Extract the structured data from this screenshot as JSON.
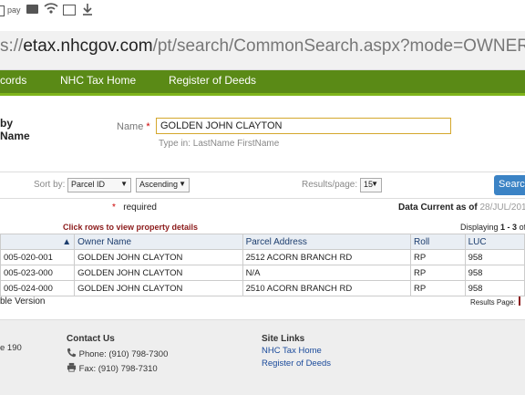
{
  "statusbar": {
    "pay_label": "pay"
  },
  "browser": {
    "url_prefix": "s://",
    "url_host": "etax.nhcgov.com",
    "url_path": "/pt/search/CommonSearch.aspx?mode=OWNER"
  },
  "nav": {
    "items": [
      "cords",
      "NHC Tax Home",
      "Register of Deeds"
    ]
  },
  "search": {
    "side_label_1": "by",
    "side_label_2": "Name",
    "name_label": "Name",
    "required_star": "*",
    "name_value": "GOLDEN JOHN CLAYTON",
    "name_hint": "Type in: LastName FirstName",
    "sort_by_label": "Sort by:",
    "sort_field": "Parcel ID",
    "sort_order": "Ascending",
    "results_per_page_label": "Results/page:",
    "results_per_page": "15",
    "search_button": "Search"
  },
  "info": {
    "required_text": "required",
    "data_current_label": "Data Current as of",
    "data_current_date": "28/JUL/201",
    "click_rows": "Click rows to view property details",
    "displaying_prefix": "Displaying",
    "displaying_range": "1 - 3",
    "displaying_suffix": "of"
  },
  "table": {
    "headers": [
      "▲",
      "Owner Name",
      "Parcel Address",
      "Roll",
      "LUC"
    ],
    "rows": [
      [
        "005-020-001",
        "GOLDEN JOHN CLAYTON",
        "2512 ACORN BRANCH RD",
        "RP",
        "958"
      ],
      [
        "005-023-000",
        "GOLDEN JOHN CLAYTON",
        "N/A",
        "RP",
        "958"
      ],
      [
        "005-024-000",
        "GOLDEN JOHN CLAYTON",
        "2510 ACORN BRANCH RD",
        "RP",
        "958"
      ]
    ]
  },
  "below_table": {
    "printable": "ble Version",
    "results_page_label": "Results Page:"
  },
  "footer": {
    "left_text": "e 190",
    "contact_heading": "Contact Us",
    "phone": "Phone: (910) 798-7300",
    "fax": "Fax: (910) 798-7310",
    "links_heading": "Site Links",
    "link_1": "NHC Tax Home",
    "link_2": "Register of Deeds"
  },
  "colors": {
    "nav_green": "#5a8a16",
    "accent_blue": "#3b83c5",
    "link_blue": "#1a4a9b"
  }
}
